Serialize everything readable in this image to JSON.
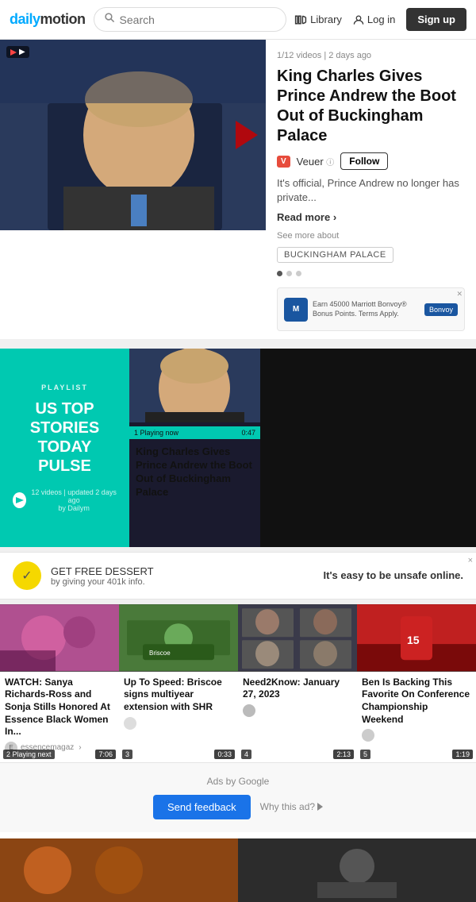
{
  "header": {
    "logo_text": "dailymotion",
    "search_placeholder": "Search",
    "nav": {
      "library_label": "Library",
      "login_label": "Log in",
      "signup_label": "Sign up"
    }
  },
  "featured": {
    "meta": "1/12 videos | 2 days ago",
    "title": "King Charles Gives Prince Andrew the Boot Out of Buckingham Palace",
    "channel_badge": "V",
    "channel_name": "Veuer",
    "channel_verified": "0",
    "follow_label": "Follow",
    "description": "It's official, Prince Andrew no longer has private...",
    "read_more_label": "Read more",
    "see_more_label": "See more about",
    "tag": "BUCKINGHAM PALACE",
    "ad_text1": "Earn 45000 Marriott Bonvoy®",
    "ad_text2": "Bonus Points. Terms Apply.",
    "ad_cta": "Bonvoy"
  },
  "playlist": {
    "label": "PLAYLIST",
    "title": "US TOP STORIES TODAY PULSE",
    "footer_text": "12 videos | updated 2 days ago",
    "footer_by": "by Dailym",
    "now_playing": "1  Playing now",
    "now_playing_duration": "0:47",
    "video_title": "King Charles Gives Prince Andrew the Boot Out of Buckingham Palace"
  },
  "ad_banner": {
    "main_text": "GET FREE DESSERT",
    "sub_text": "by giving your 401k info.",
    "cta_text": "It's easy to be unsafe online.",
    "close_label": "×"
  },
  "video_grid": {
    "items": [
      {
        "badge": "2  Playing next",
        "duration": "7:06",
        "title": "WATCH: Sanya Richards-Ross and Sonja Stills Honored At Essence Black Women In...",
        "channel": "essencemagaz",
        "channel_icon": "E"
      },
      {
        "badge": "3",
        "duration": "0:33",
        "title": "Up To Speed: Briscoe signs multiyear extension with SHR",
        "channel": "",
        "channel_icon": "N"
      },
      {
        "badge": "4",
        "duration": "2:13",
        "title": "Need2Know: January 27, 2023",
        "channel": "",
        "channel_icon": "N"
      },
      {
        "badge": "5",
        "duration": "1:19",
        "title": "Ben Is Backing This Favorite On Conference Championship Weekend",
        "channel": "",
        "channel_icon": "B"
      }
    ]
  },
  "google_ads": {
    "label": "Ads by Google",
    "feedback_label": "Send feedback",
    "why_label": "Why this ad?"
  },
  "bottom_row": {
    "left_color": "#8B4513",
    "right_color": "#2c2c2c"
  },
  "colors": {
    "accent_teal": "#00c9b1",
    "accent_blue": "#1a73e8",
    "dark": "#111111",
    "brand_blue": "#0077ff"
  }
}
